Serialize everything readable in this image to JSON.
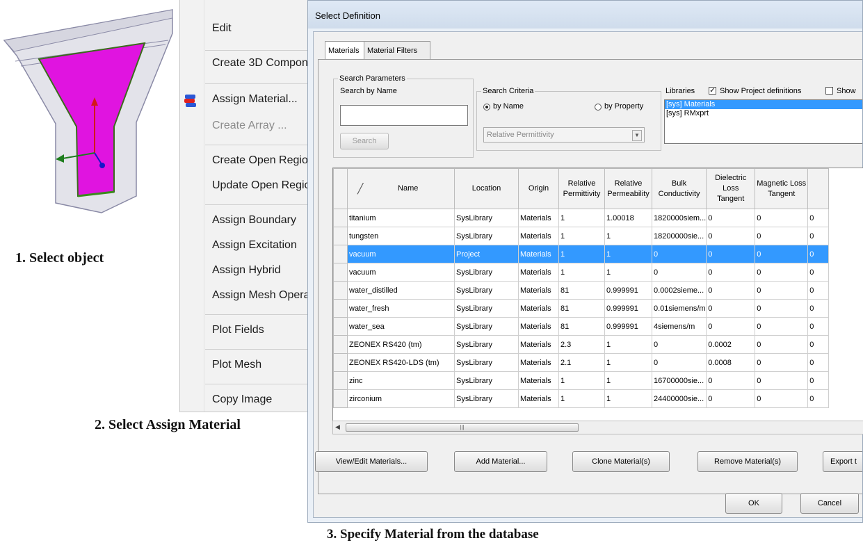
{
  "captions": {
    "step1": "1. Select object",
    "step2": "2. Select Assign Material",
    "step3": "3. Specify Material from the database"
  },
  "context_menu": {
    "items": [
      {
        "label": "Edit",
        "enabled": true
      },
      {
        "label": "Create 3D Compon",
        "enabled": true
      },
      {
        "label": "Assign Material...",
        "enabled": true,
        "icon": "material-icon"
      },
      {
        "label": "Create Array ...",
        "enabled": false
      },
      {
        "label": "Create Open Regio",
        "enabled": true
      },
      {
        "label": "Update Open Regio",
        "enabled": true
      },
      {
        "label": "Assign Boundary",
        "enabled": true
      },
      {
        "label": "Assign Excitation",
        "enabled": true
      },
      {
        "label": "Assign Hybrid",
        "enabled": true
      },
      {
        "label": "Assign Mesh Opera",
        "enabled": true
      },
      {
        "label": "Plot Fields",
        "enabled": true
      },
      {
        "label": "Plot Mesh",
        "enabled": true
      },
      {
        "label": "Copy Image",
        "enabled": true
      }
    ]
  },
  "dialog": {
    "title": "Select Definition",
    "tabs": [
      "Materials",
      "Material Filters"
    ],
    "search_parameters": {
      "group_label": "Search Parameters",
      "search_by_name_label": "Search by Name",
      "search_value": "",
      "search_button": "Search"
    },
    "search_criteria": {
      "group_label": "Search Criteria",
      "by_name": "by Name",
      "by_property": "by Property",
      "selected": "by Name",
      "property_dropdown": "Relative Permittivity"
    },
    "libraries": {
      "label": "Libraries",
      "show_project_definitions": "Show Project definitions",
      "show_project_checked": true,
      "show_cut": "Show",
      "items": [
        "[sys] Materials",
        "[sys] RMxprt"
      ],
      "selected": "[sys] Materials"
    },
    "table": {
      "sort_icon": "sort-icon",
      "columns": [
        "Name",
        "Location",
        "Origin",
        "Relative Permittivity",
        "Relative Permeability",
        "Bulk Conductivity",
        "Dielectric Loss Tangent",
        "Magnetic Loss Tangent",
        ""
      ],
      "rows": [
        [
          "titanium",
          "SysLibrary",
          "Materials",
          "1",
          "1.00018",
          "1820000siem...",
          "0",
          "0",
          "0"
        ],
        [
          "tungsten",
          "SysLibrary",
          "Materials",
          "1",
          "1",
          "18200000sie...",
          "0",
          "0",
          "0"
        ],
        [
          "vacuum",
          "Project",
          "Materials",
          "1",
          "1",
          "0",
          "0",
          "0",
          "0"
        ],
        [
          "vacuum",
          "SysLibrary",
          "Materials",
          "1",
          "1",
          "0",
          "0",
          "0",
          "0"
        ],
        [
          "water_distilled",
          "SysLibrary",
          "Materials",
          "81",
          "0.999991",
          "0.0002sieme...",
          "0",
          "0",
          "0"
        ],
        [
          "water_fresh",
          "SysLibrary",
          "Materials",
          "81",
          "0.999991",
          "0.01siemens/m",
          "0",
          "0",
          "0"
        ],
        [
          "water_sea",
          "SysLibrary",
          "Materials",
          "81",
          "0.999991",
          "4siemens/m",
          "0",
          "0",
          "0"
        ],
        [
          "ZEONEX RS420 (tm)",
          "SysLibrary",
          "Materials",
          "2.3",
          "1",
          "0",
          "0.0002",
          "0",
          "0"
        ],
        [
          "ZEONEX RS420-LDS (tm)",
          "SysLibrary",
          "Materials",
          "2.1",
          "1",
          "0",
          "0.0008",
          "0",
          "0"
        ],
        [
          "zinc",
          "SysLibrary",
          "Materials",
          "1",
          "1",
          "16700000sie...",
          "0",
          "0",
          "0"
        ],
        [
          "zirconium",
          "SysLibrary",
          "Materials",
          "1",
          "1",
          "24400000sie...",
          "0",
          "0",
          "0"
        ]
      ],
      "selected_row": 2
    },
    "buttons": {
      "view_edit": "View/Edit Materials...",
      "add": "Add Material...",
      "clone": "Clone Material(s)",
      "remove": "Remove Material(s)",
      "export": "Export t",
      "ok": "OK",
      "cancel": "Cancel"
    }
  },
  "colors": {
    "object_fill": "#e014e0",
    "selection": "#3399ff"
  }
}
